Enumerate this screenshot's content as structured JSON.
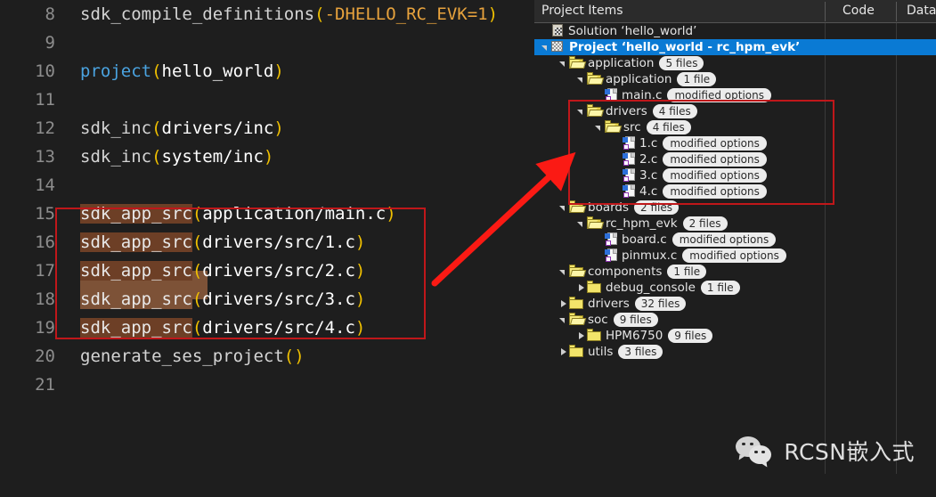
{
  "editor": {
    "lines": [
      {
        "num": "8",
        "segments": [
          {
            "t": "sdk_compile_definitions",
            "c": "fn"
          },
          {
            "t": "(",
            "c": "paren"
          },
          {
            "t": "-DHELLO_RC_EVK=1",
            "c": "orange"
          },
          {
            "t": ")",
            "c": "paren"
          }
        ]
      },
      {
        "num": "9",
        "segments": []
      },
      {
        "num": "10",
        "segments": [
          {
            "t": "project",
            "c": "kw"
          },
          {
            "t": "(",
            "c": "paren"
          },
          {
            "t": "hello_world",
            "c": "arg"
          },
          {
            "t": ")",
            "c": "paren"
          }
        ]
      },
      {
        "num": "11",
        "segments": []
      },
      {
        "num": "12",
        "segments": [
          {
            "t": "sdk_inc",
            "c": "fn"
          },
          {
            "t": "(",
            "c": "paren"
          },
          {
            "t": "drivers/inc",
            "c": "arg"
          },
          {
            "t": ")",
            "c": "paren"
          }
        ]
      },
      {
        "num": "13",
        "segments": [
          {
            "t": "sdk_inc",
            "c": "fn"
          },
          {
            "t": "(",
            "c": "paren"
          },
          {
            "t": "system/inc",
            "c": "arg"
          },
          {
            "t": ")",
            "c": "paren"
          }
        ]
      },
      {
        "num": "14",
        "segments": []
      },
      {
        "num": "15",
        "segments": [
          {
            "t": "sdk_app_src",
            "c": "hl"
          },
          {
            "t": "(",
            "c": "paren"
          },
          {
            "t": "application/main.c",
            "c": "arg"
          },
          {
            "t": ")",
            "c": "paren"
          }
        ]
      },
      {
        "num": "16",
        "segments": [
          {
            "t": "sdk_app_src",
            "c": "hl"
          },
          {
            "t": "(",
            "c": "paren"
          },
          {
            "t": "drivers/src/1.c",
            "c": "arg"
          },
          {
            "t": ")",
            "c": "paren"
          }
        ]
      },
      {
        "num": "17",
        "segments": [
          {
            "t": "sdk_app_src",
            "c": "hl"
          },
          {
            "t": "(",
            "c": "paren"
          },
          {
            "t": "drivers/src/2.c",
            "c": "arg"
          },
          {
            "t": ")",
            "c": "paren"
          }
        ]
      },
      {
        "num": "18",
        "segments": [
          {
            "t": "sdk_app_src",
            "c": "hl-cur"
          },
          {
            "t": "(",
            "c": "paren"
          },
          {
            "t": "drivers/src/3.c",
            "c": "arg"
          },
          {
            "t": ")",
            "c": "paren"
          }
        ]
      },
      {
        "num": "19",
        "segments": [
          {
            "t": "sdk_app_src",
            "c": "hl"
          },
          {
            "t": "(",
            "c": "paren"
          },
          {
            "t": "drivers/src/4.c",
            "c": "arg"
          },
          {
            "t": ")",
            "c": "paren"
          }
        ]
      },
      {
        "num": "20",
        "segments": [
          {
            "t": "generate_ses_project",
            "c": "fn"
          },
          {
            "t": "()",
            "c": "paren"
          }
        ]
      },
      {
        "num": "21",
        "segments": []
      }
    ]
  },
  "panel": {
    "columns": [
      {
        "label": "Project Items"
      },
      {
        "label": "Code"
      },
      {
        "label": "Data+RO"
      }
    ],
    "rows": [
      {
        "depth": 0,
        "twisty": "none",
        "icon": "solution-icon",
        "label": "Solution ‘hello_world’",
        "badge": "",
        "selected": false,
        "bold": false
      },
      {
        "depth": 0,
        "twisty": "open",
        "icon": "project-icon",
        "label": "Project ‘hello_world - rc_hpm_evk’",
        "badge": "",
        "selected": true,
        "bold": true
      },
      {
        "depth": 1,
        "twisty": "open",
        "icon": "folder-open",
        "label": "application",
        "badge": "5 files",
        "selected": false,
        "bold": false
      },
      {
        "depth": 2,
        "twisty": "open",
        "icon": "folder-open",
        "label": "application",
        "badge": "1 file",
        "selected": false,
        "bold": false
      },
      {
        "depth": 3,
        "twisty": "none",
        "icon": "c-file-icon",
        "label": "main.c",
        "badge": "modified options",
        "selected": false,
        "bold": false
      },
      {
        "depth": 2,
        "twisty": "open",
        "icon": "folder-open",
        "label": "drivers",
        "badge": "4 files",
        "selected": false,
        "bold": false
      },
      {
        "depth": 3,
        "twisty": "open",
        "icon": "folder-open",
        "label": "src",
        "badge": "4 files",
        "selected": false,
        "bold": false
      },
      {
        "depth": 4,
        "twisty": "none",
        "icon": "c-file-icon",
        "label": "1.c",
        "badge": "modified options",
        "selected": false,
        "bold": false
      },
      {
        "depth": 4,
        "twisty": "none",
        "icon": "c-file-icon",
        "label": "2.c",
        "badge": "modified options",
        "selected": false,
        "bold": false
      },
      {
        "depth": 4,
        "twisty": "none",
        "icon": "c-file-icon",
        "label": "3.c",
        "badge": "modified options",
        "selected": false,
        "bold": false
      },
      {
        "depth": 4,
        "twisty": "none",
        "icon": "c-file-icon",
        "label": "4.c",
        "badge": "modified options",
        "selected": false,
        "bold": false
      },
      {
        "depth": 1,
        "twisty": "open",
        "icon": "folder-open",
        "label": "boards",
        "badge": "2 files",
        "selected": false,
        "bold": false
      },
      {
        "depth": 2,
        "twisty": "open",
        "icon": "folder-open",
        "label": "rc_hpm_evk",
        "badge": "2 files",
        "selected": false,
        "bold": false
      },
      {
        "depth": 3,
        "twisty": "none",
        "icon": "c-file-icon",
        "label": "board.c",
        "badge": "modified options",
        "selected": false,
        "bold": false
      },
      {
        "depth": 3,
        "twisty": "none",
        "icon": "c-file-icon",
        "label": "pinmux.c",
        "badge": "modified options",
        "selected": false,
        "bold": false
      },
      {
        "depth": 1,
        "twisty": "open",
        "icon": "folder-open",
        "label": "components",
        "badge": "1 file",
        "selected": false,
        "bold": false
      },
      {
        "depth": 2,
        "twisty": "closed",
        "icon": "folder-closed",
        "label": "debug_console",
        "badge": "1 file",
        "selected": false,
        "bold": false
      },
      {
        "depth": 1,
        "twisty": "closed",
        "icon": "folder-closed",
        "label": "drivers",
        "badge": "32 files",
        "selected": false,
        "bold": false
      },
      {
        "depth": 1,
        "twisty": "open",
        "icon": "folder-open",
        "label": "soc",
        "badge": "9 files",
        "selected": false,
        "bold": false
      },
      {
        "depth": 2,
        "twisty": "closed",
        "icon": "folder-closed",
        "label": "HPM6750",
        "badge": "9 files",
        "selected": false,
        "bold": false
      },
      {
        "depth": 1,
        "twisty": "closed",
        "icon": "folder-closed",
        "label": "utils",
        "badge": "3 files",
        "selected": false,
        "bold": false
      }
    ]
  },
  "annotations": {
    "color": "#c0171a",
    "arrow_color": "#fb1a14",
    "editor_rect_label": "code-highlight-rect",
    "tree_rect_label": "tree-highlight-rect",
    "arrow_label": "pointer-arrow"
  },
  "watermark": {
    "text": "RCSN嵌入式",
    "icon": "wechat-icon"
  }
}
